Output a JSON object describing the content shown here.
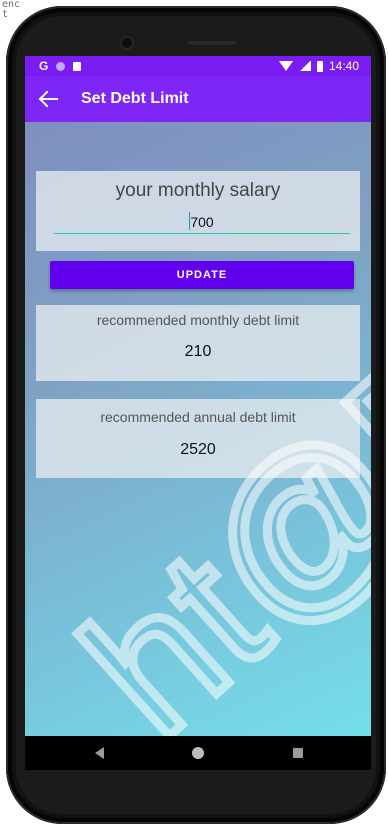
{
  "ide": {
    "line1": "enc",
    "line2": "t"
  },
  "status_bar": {
    "carrier_letter": "G",
    "time": "14:40"
  },
  "app_bar": {
    "title": "Set Debt Limit",
    "back_icon": "arrow-left-icon"
  },
  "salary": {
    "label": "your monthly salary",
    "value": "700"
  },
  "update_button": {
    "label": "UPDATE"
  },
  "monthly": {
    "label": "recommended monthly debt limit",
    "value": "210"
  },
  "annual": {
    "label": "recommended annual debt limit",
    "value": "2520"
  },
  "watermark": {
    "text": "ht@F"
  },
  "colors": {
    "app_bar": "#7d26f6",
    "status_bar": "#7a1df2",
    "button": "#6200ee",
    "input_underline": "#21c9b5"
  }
}
